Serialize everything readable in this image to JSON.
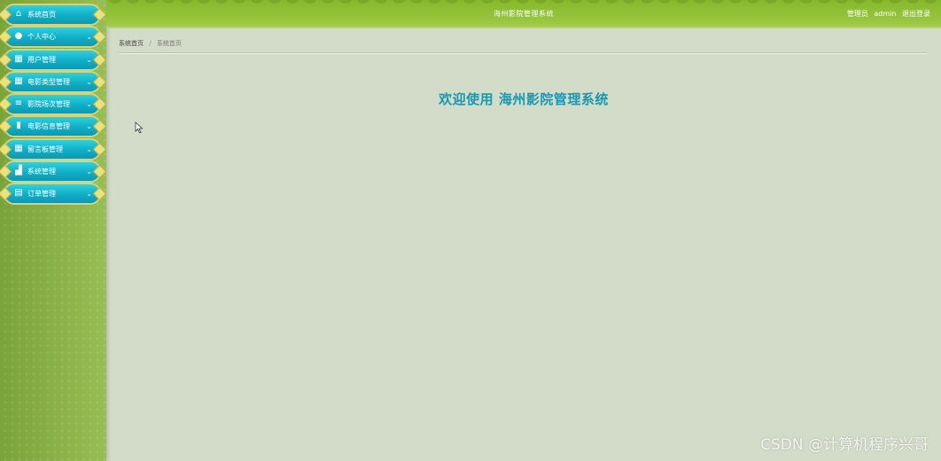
{
  "header": {
    "title": "海州影院管理系统",
    "role_label": "管理员",
    "username": "admin",
    "logout_label": "退出登录"
  },
  "sidebar": {
    "items": [
      {
        "label": "系统首页",
        "icon": "home-icon"
      },
      {
        "label": "个人中心",
        "icon": "user-icon"
      },
      {
        "label": "用户管理",
        "icon": "grid-icon"
      },
      {
        "label": "电影类型管理",
        "icon": "grid-icon"
      },
      {
        "label": "影院场次管理",
        "icon": "sliders-icon"
      },
      {
        "label": "电影信息管理",
        "icon": "film-icon"
      },
      {
        "label": "留言板管理",
        "icon": "grid-icon"
      },
      {
        "label": "系统管理",
        "icon": "chart-icon"
      },
      {
        "label": "订单管理",
        "icon": "clipboard-icon"
      }
    ]
  },
  "breadcrumb": {
    "root": "系统首页",
    "separator": "/",
    "current": "系统首页"
  },
  "main": {
    "welcome": "欢迎使用 海州影院管理系统"
  },
  "watermark": "CSDN @计算机程序兴哥",
  "colors": {
    "topbar": "#96c43d",
    "sidebar": "#8fb54d",
    "menu_item": "#10aec6",
    "welcome_text": "#1798b1",
    "background": "#d3dcc9"
  }
}
